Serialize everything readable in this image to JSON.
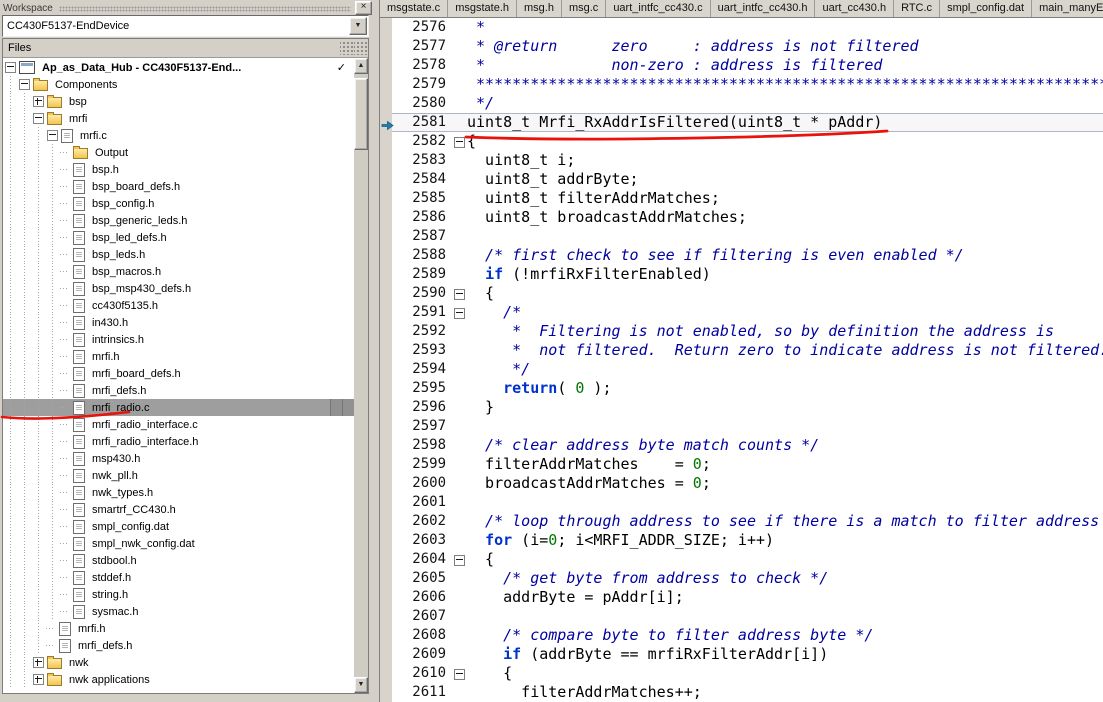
{
  "colors": {
    "annotation_red": "#e8140c",
    "keyword_blue": "#0033cc",
    "comment_navy": "#0000a0",
    "number_green": "#007600",
    "selection_gray": "#9e9e9e",
    "chrome_gray": "#d4d0c8"
  },
  "workspace": {
    "title": "Workspace",
    "config": "CC430F5137-EndDevice",
    "files_header": "Files",
    "icons": {
      "close": "×",
      "dropdown": "▼",
      "scroll_up": "▲",
      "scroll_down": "▼"
    },
    "tree": [
      {
        "label": "Ap_as_Data_Hub - CC430F5137-End...",
        "depth": 0,
        "type": "project",
        "exp": "minus",
        "bold": true,
        "check": "✓"
      },
      {
        "label": "Components",
        "depth": 1,
        "type": "folder",
        "exp": "minus"
      },
      {
        "label": "bsp",
        "depth": 2,
        "type": "folder",
        "exp": "plus"
      },
      {
        "label": "mrfi",
        "depth": 2,
        "type": "folder",
        "exp": "minus"
      },
      {
        "label": "mrfi.c",
        "depth": 3,
        "type": "cfile",
        "exp": "minus"
      },
      {
        "label": "Output",
        "depth": 4,
        "type": "folder"
      },
      {
        "label": "bsp.h",
        "depth": 4,
        "type": "hfile"
      },
      {
        "label": "bsp_board_defs.h",
        "depth": 4,
        "type": "hfile"
      },
      {
        "label": "bsp_config.h",
        "depth": 4,
        "type": "hfile"
      },
      {
        "label": "bsp_generic_leds.h",
        "depth": 4,
        "type": "hfile"
      },
      {
        "label": "bsp_led_defs.h",
        "depth": 4,
        "type": "hfile"
      },
      {
        "label": "bsp_leds.h",
        "depth": 4,
        "type": "hfile"
      },
      {
        "label": "bsp_macros.h",
        "depth": 4,
        "type": "hfile"
      },
      {
        "label": "bsp_msp430_defs.h",
        "depth": 4,
        "type": "hfile"
      },
      {
        "label": "cc430f5135.h",
        "depth": 4,
        "type": "hfile"
      },
      {
        "label": "in430.h",
        "depth": 4,
        "type": "hfile"
      },
      {
        "label": "intrinsics.h",
        "depth": 4,
        "type": "hfile"
      },
      {
        "label": "mrfi.h",
        "depth": 4,
        "type": "hfile"
      },
      {
        "label": "mrfi_board_defs.h",
        "depth": 4,
        "type": "hfile"
      },
      {
        "label": "mrfi_defs.h",
        "depth": 4,
        "type": "hfile"
      },
      {
        "label": "mrfi_radio.c",
        "depth": 4,
        "type": "cfile",
        "selected": true
      },
      {
        "label": "mrfi_radio_interface.c",
        "depth": 4,
        "type": "cfile"
      },
      {
        "label": "mrfi_radio_interface.h",
        "depth": 4,
        "type": "hfile"
      },
      {
        "label": "msp430.h",
        "depth": 4,
        "type": "hfile"
      },
      {
        "label": "nwk_pll.h",
        "depth": 4,
        "type": "hfile"
      },
      {
        "label": "nwk_types.h",
        "depth": 4,
        "type": "hfile"
      },
      {
        "label": "smartrf_CC430.h",
        "depth": 4,
        "type": "hfile"
      },
      {
        "label": "smpl_config.dat",
        "depth": 4,
        "type": "datfile"
      },
      {
        "label": "smpl_nwk_config.dat",
        "depth": 4,
        "type": "datfile"
      },
      {
        "label": "stdbool.h",
        "depth": 4,
        "type": "hfile"
      },
      {
        "label": "stddef.h",
        "depth": 4,
        "type": "hfile"
      },
      {
        "label": "string.h",
        "depth": 4,
        "type": "hfile"
      },
      {
        "label": "sysmac.h",
        "depth": 4,
        "type": "hfile"
      },
      {
        "label": "mrfi.h",
        "depth": 3,
        "type": "hfile"
      },
      {
        "label": "mrfi_defs.h",
        "depth": 3,
        "type": "hfile"
      },
      {
        "label": "nwk",
        "depth": 2,
        "type": "folder",
        "exp": "plus"
      },
      {
        "label": "nwk applications",
        "depth": 2,
        "type": "folder",
        "exp": "plus"
      }
    ]
  },
  "editor": {
    "tabs": [
      "msgstate.c",
      "msgstate.h",
      "msg.h",
      "msg.c",
      "uart_intfc_cc430.c",
      "uart_intfc_cc430.h",
      "uart_cc430.h",
      "RTC.c",
      "smpl_config.dat",
      "main_manyEDs_autoack"
    ],
    "lines": [
      {
        "n": 2576,
        "seg": [
          [
            "c",
            " *"
          ]
        ]
      },
      {
        "n": 2577,
        "seg": [
          [
            "c",
            " * @return      zero     : address is not filtered"
          ]
        ]
      },
      {
        "n": 2578,
        "seg": [
          [
            "c",
            " *              non-zero : address is filtered"
          ]
        ]
      },
      {
        "n": 2579,
        "seg": [
          [
            "c",
            " **************************************************************************************************************"
          ]
        ]
      },
      {
        "n": 2580,
        "seg": [
          [
            "c",
            " */"
          ]
        ]
      },
      {
        "n": 2581,
        "seg": [
          [
            "p",
            "uint8_t Mrfi_RxAddrIsFiltered(uint8_t * pAddr)"
          ]
        ],
        "marker": true,
        "current": true
      },
      {
        "n": 2582,
        "seg": [
          [
            "p",
            "{"
          ]
        ],
        "fold": true
      },
      {
        "n": 2583,
        "seg": [
          [
            "p",
            "  uint8_t i;"
          ]
        ]
      },
      {
        "n": 2584,
        "seg": [
          [
            "p",
            "  uint8_t addrByte;"
          ]
        ]
      },
      {
        "n": 2585,
        "seg": [
          [
            "p",
            "  uint8_t filterAddrMatches;"
          ]
        ]
      },
      {
        "n": 2586,
        "seg": [
          [
            "p",
            "  uint8_t broadcastAddrMatches;"
          ]
        ]
      },
      {
        "n": 2587,
        "seg": []
      },
      {
        "n": 2588,
        "seg": [
          [
            "c",
            "  /* first check to see if filtering is even enabled */"
          ]
        ]
      },
      {
        "n": 2589,
        "seg": [
          [
            "p",
            "  "
          ],
          [
            "k",
            "if"
          ],
          [
            "p",
            " (!mrfiRxFilterEnabled)"
          ]
        ]
      },
      {
        "n": 2590,
        "seg": [
          [
            "p",
            "  {"
          ]
        ],
        "fold": true
      },
      {
        "n": 2591,
        "seg": [
          [
            "p",
            "    "
          ],
          [
            "c",
            "/*"
          ]
        ],
        "fold": true
      },
      {
        "n": 2592,
        "seg": [
          [
            "c",
            "     *  Filtering is not enabled, so by definition the address is"
          ]
        ]
      },
      {
        "n": 2593,
        "seg": [
          [
            "c",
            "     *  not filtered.  Return zero to indicate address is not filtered."
          ]
        ]
      },
      {
        "n": 2594,
        "seg": [
          [
            "c",
            "     */"
          ]
        ]
      },
      {
        "n": 2595,
        "seg": [
          [
            "p",
            "    "
          ],
          [
            "k",
            "return"
          ],
          [
            "p",
            "( "
          ],
          [
            "n2",
            "0"
          ],
          [
            "p",
            " );"
          ]
        ]
      },
      {
        "n": 2596,
        "seg": [
          [
            "p",
            "  }"
          ]
        ]
      },
      {
        "n": 2597,
        "seg": []
      },
      {
        "n": 2598,
        "seg": [
          [
            "c",
            "  /* clear address byte match counts */"
          ]
        ]
      },
      {
        "n": 2599,
        "seg": [
          [
            "p",
            "  filterAddrMatches    = "
          ],
          [
            "n2",
            "0"
          ],
          [
            "p",
            ";"
          ]
        ]
      },
      {
        "n": 2600,
        "seg": [
          [
            "p",
            "  broadcastAddrMatches = "
          ],
          [
            "n2",
            "0"
          ],
          [
            "p",
            ";"
          ]
        ]
      },
      {
        "n": 2601,
        "seg": []
      },
      {
        "n": 2602,
        "seg": [
          [
            "c",
            "  /* loop through address to see if there is a match to filter address */"
          ]
        ]
      },
      {
        "n": 2603,
        "seg": [
          [
            "p",
            "  "
          ],
          [
            "k",
            "for"
          ],
          [
            "p",
            " (i="
          ],
          [
            "n2",
            "0"
          ],
          [
            "p",
            "; i<MRFI_ADDR_SIZE; i++)"
          ]
        ]
      },
      {
        "n": 2604,
        "seg": [
          [
            "p",
            "  {"
          ]
        ],
        "fold": true
      },
      {
        "n": 2605,
        "seg": [
          [
            "c",
            "    /* get byte from address to check */"
          ]
        ]
      },
      {
        "n": 2606,
        "seg": [
          [
            "p",
            "    addrByte = pAddr[i];"
          ]
        ]
      },
      {
        "n": 2607,
        "seg": []
      },
      {
        "n": 2608,
        "seg": [
          [
            "c",
            "    /* compare byte to filter address byte */"
          ]
        ]
      },
      {
        "n": 2609,
        "seg": [
          [
            "p",
            "    "
          ],
          [
            "k",
            "if"
          ],
          [
            "p",
            " (addrByte == mrfiRxFilterAddr[i])"
          ]
        ]
      },
      {
        "n": 2610,
        "seg": [
          [
            "p",
            "    {"
          ]
        ],
        "fold": true
      },
      {
        "n": 2611,
        "seg": [
          [
            "p",
            "      filterAddrMatches++;"
          ]
        ]
      }
    ]
  }
}
